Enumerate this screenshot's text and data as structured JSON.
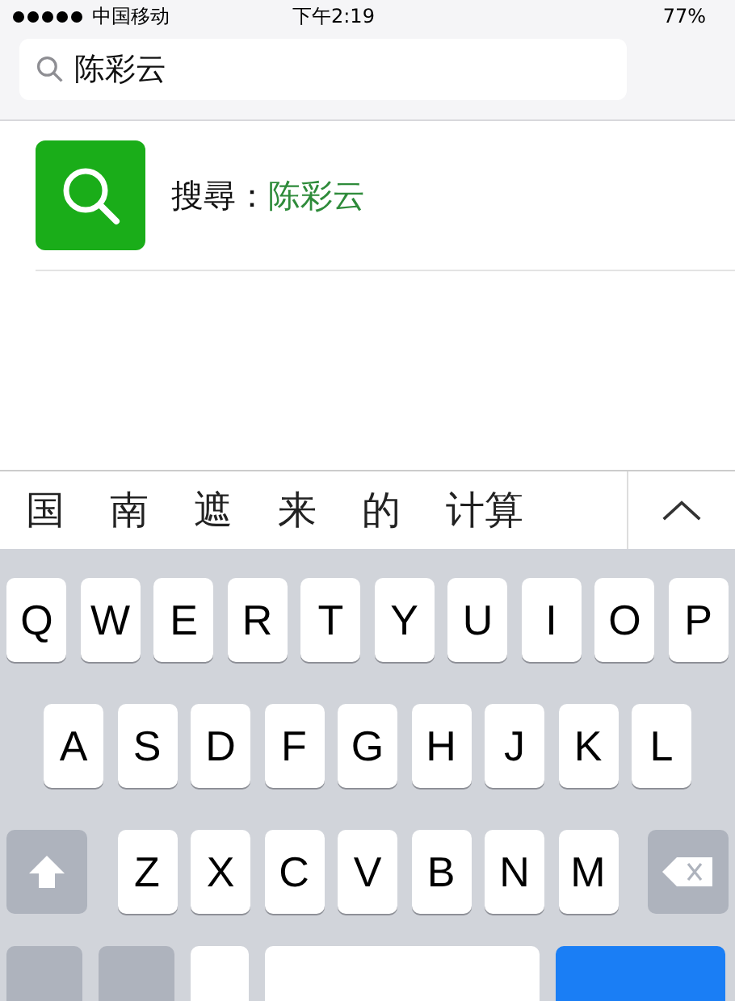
{
  "status_bar": {
    "carrier": "中国移动",
    "time": "下午2:19",
    "battery": "77%"
  },
  "search": {
    "value": "陈彩云"
  },
  "result": {
    "label": "搜尋：",
    "query": "陈彩云"
  },
  "candidates": [
    "国",
    "南",
    "遮",
    "来",
    "的",
    "计算"
  ],
  "keyboard": {
    "rows": [
      [
        "Q",
        "W",
        "E",
        "R",
        "T",
        "Y",
        "U",
        "I",
        "O",
        "P"
      ],
      [
        "A",
        "S",
        "D",
        "F",
        "G",
        "H",
        "J",
        "K",
        "L"
      ],
      [
        "Z",
        "X",
        "C",
        "V",
        "B",
        "N",
        "M"
      ]
    ],
    "bottom_row": [
      {
        "kind": "function"
      },
      {
        "kind": "function"
      },
      {
        "kind": "letter"
      },
      {
        "kind": "space"
      },
      {
        "kind": "return"
      }
    ]
  }
}
